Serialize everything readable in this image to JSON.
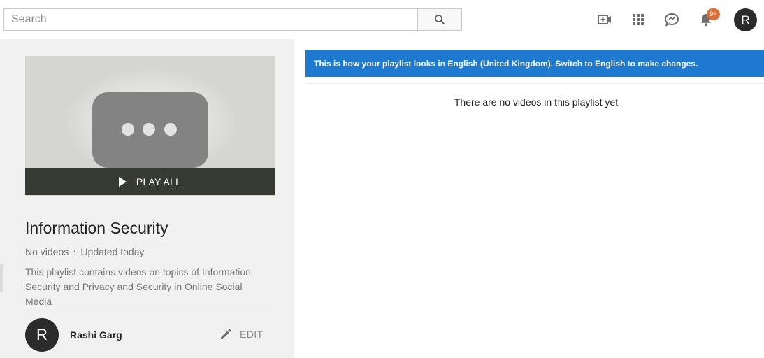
{
  "header": {
    "search_placeholder": "Search",
    "search_icon": "search-icon",
    "icons": [
      "upload-video-icon",
      "apps-grid-icon",
      "messages-icon",
      "notifications-bell-icon"
    ],
    "notification_badge": "9+",
    "avatar_letter": "R"
  },
  "playlist": {
    "play_all_label": "PLAY ALL",
    "title": "Information Security",
    "video_count": "No videos",
    "separator": "•",
    "updated": "Updated today",
    "description": "This playlist contains videos on topics of Information Security and Privacy and Security in Online Social Media",
    "owner": {
      "avatar_letter": "R",
      "name": "Rashi Garg"
    },
    "edit_label": "EDIT"
  },
  "main": {
    "banner_text": "This is how your playlist looks in English (United Kingdom). Switch to English to make changes.",
    "empty_message": "There are no videos in this playlist yet"
  },
  "colors": {
    "banner": "#1e7ad0",
    "badge": "#d66f3b",
    "play_bar": "#373a33",
    "panel_bg": "#f1f1f1"
  }
}
